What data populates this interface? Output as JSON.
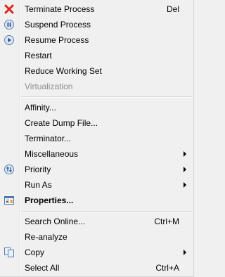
{
  "menu": {
    "items": [
      {
        "label": "Terminate Process",
        "shortcut": "Del",
        "icon": "close-icon"
      },
      {
        "label": "Suspend Process",
        "icon": "pause-icon"
      },
      {
        "label": "Resume Process",
        "icon": "play-icon"
      },
      {
        "label": "Restart"
      },
      {
        "label": "Reduce Working Set"
      },
      {
        "label": "Virtualization",
        "disabled": true
      },
      {
        "label": "Affinity..."
      },
      {
        "label": "Create Dump File..."
      },
      {
        "label": "Terminator..."
      },
      {
        "label": "Miscellaneous",
        "submenu": true
      },
      {
        "label": "Priority",
        "submenu": true,
        "icon": "priority-icon"
      },
      {
        "label": "Run As",
        "submenu": true
      },
      {
        "label": "Properties...",
        "bold": true,
        "icon": "properties-icon"
      },
      {
        "label": "Search Online...",
        "shortcut": "Ctrl+M"
      },
      {
        "label": "Re-analyze"
      },
      {
        "label": "Copy",
        "submenu": true,
        "icon": "copy-icon"
      },
      {
        "label": "Select All",
        "shortcut": "Ctrl+A"
      }
    ]
  }
}
